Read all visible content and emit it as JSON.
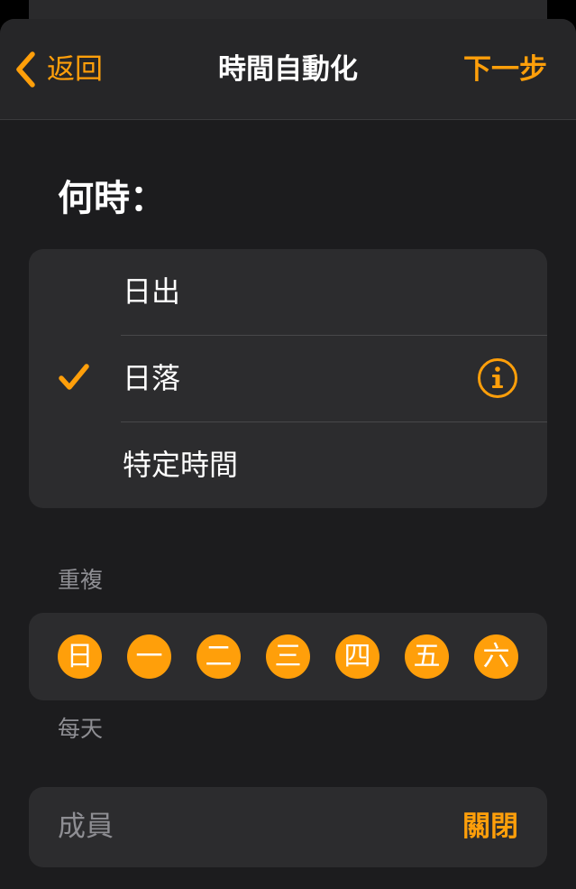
{
  "nav": {
    "back_label": "返回",
    "title": "時間自動化",
    "next_label": "下一步"
  },
  "when": {
    "heading": "何時：",
    "options": [
      {
        "label": "日出",
        "selected": false
      },
      {
        "label": "日落",
        "selected": true,
        "has_info": true
      },
      {
        "label": "特定時間",
        "selected": false
      }
    ]
  },
  "repeat": {
    "label": "重複",
    "days": [
      "日",
      "一",
      "二",
      "三",
      "四",
      "五",
      "六"
    ],
    "summary": "每天"
  },
  "members": {
    "label": "成員",
    "value": "關閉"
  },
  "colors": {
    "accent": "#ff9f0a",
    "background": "#1c1c1e",
    "card": "#2c2c2e",
    "secondary_text": "#8e8e93"
  },
  "icons": {
    "back": "chevron-left-icon",
    "check": "checkmark-icon",
    "info": "info-circle-icon"
  }
}
